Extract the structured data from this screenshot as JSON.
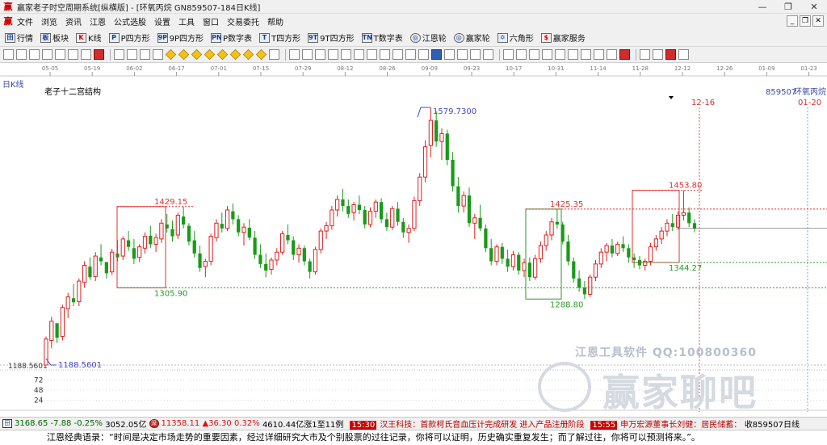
{
  "window": {
    "title": "赢家老子时空周期系统[纵横版] - [环氧丙烷  GN859507-184日K线]",
    "controls": [
      "—",
      "❐",
      "✕"
    ],
    "mdi_controls": [
      "_",
      "❐",
      "✕"
    ]
  },
  "menu": [
    "文件",
    "浏览",
    "资讯",
    "江恩",
    "公式选股",
    "设置",
    "工具",
    "窗口",
    "交易委托",
    "帮助"
  ],
  "toolbar": [
    {
      "icon": "grid-icon",
      "glyph": "田",
      "label": "行情"
    },
    {
      "icon": "blocks-icon",
      "glyph": "板",
      "label": "板块"
    },
    {
      "icon": "kline-icon",
      "glyph": "K",
      "label": "K线"
    },
    {
      "icon": "square-icon",
      "glyph": "P",
      "label": "P四方形"
    },
    {
      "icon": "square-icon",
      "glyph": "9P",
      "label": "9P四方形"
    },
    {
      "icon": "square-icon",
      "glyph": "PN",
      "label": "P数字表"
    },
    {
      "icon": "square-icon",
      "glyph": "T",
      "label": "T四方形"
    },
    {
      "icon": "square-icon",
      "glyph": "9T",
      "label": "9T四方形"
    },
    {
      "icon": "table-icon",
      "glyph": "TN",
      "label": "T数字表"
    },
    {
      "icon": "wheel-icon",
      "glyph": "◎",
      "label": "江恩轮"
    },
    {
      "icon": "wheel-icon",
      "glyph": "◎",
      "label": "赢家轮"
    },
    {
      "icon": "hexagon-icon",
      "glyph": "✡",
      "label": "六角形"
    },
    {
      "icon": "dollar-icon",
      "glyph": "$",
      "label": "赢家服务"
    }
  ],
  "chart_panel": {
    "period_label": "日K线",
    "indicator_label": "老子十二宫结构",
    "code_label": "859507",
    "name_label": "环氧丙烷",
    "date_marker_1": "12-16",
    "date_marker_2": "01-20"
  },
  "status": {
    "index1": "3168.65",
    "index1_change": "-7.88",
    "index1_pct": "-0.25%",
    "index1_amount": "3052.05亿",
    "index2": "11358.11",
    "index2_change": "▲36.30",
    "index2_pct": "0.32%",
    "index2_amount": "4610.44亿",
    "ratio": "涨1至11例",
    "news_time": "15:30",
    "news_text": "汉王科技：首款柯氏音血压计完成研发 进入产品注册阶段",
    "news_time2": "15:55",
    "news_text2": "申万宏源董事长刘健：居民储蓄：",
    "end_label": "收859507日线"
  },
  "quote": "江恩经典语录：“时间是决定市场走势的重要因素，经过详细研究大市及个别股票的过往记录，你将可以证明，历史确实重复发生；而了解过往，你将可以预测将来。”。",
  "watermark": {
    "line1": "江恩工具软件  QQ:100800360",
    "line2": "赢家聊吧"
  },
  "colors": {
    "up": "#e02020",
    "down": "#1a9a1a",
    "green_line": "#2a9a2a",
    "red_line": "#e03030",
    "blue_line": "#4444cc",
    "axis_text": "#3b4aa6"
  },
  "chart_data": {
    "type": "candlestick",
    "series_name": "环氧丙烷",
    "x_tick_labels": [
      "05-05",
      "05-19",
      "06-02",
      "06-17",
      "07-01",
      "07-15",
      "07-29",
      "08-12",
      "08-26",
      "09-09",
      "09-23",
      "10-17",
      "10-31",
      "11-14",
      "11-28",
      "12-12",
      "12-26",
      "01-09",
      "01-23"
    ],
    "price_labels": {
      "low": "1188.5601",
      "low_axis": "1188.5601",
      "high": "1579.7300",
      "box1_top": "1429.15",
      "box1_bottom": "1305.90",
      "box2_top": "1425.35",
      "box2_bottom": "1288.80",
      "box3_top": "1453.80",
      "box3_bottom": "1344.27"
    },
    "volume_axis_ticks": [
      "72",
      "48",
      "24"
    ],
    "ohlc": [
      [
        1188.56,
        1232,
        1188.56,
        1228
      ],
      [
        1226,
        1262,
        1214,
        1255
      ],
      [
        1252,
        1248,
        1222,
        1230
      ],
      [
        1232,
        1280,
        1226,
        1276
      ],
      [
        1274,
        1298,
        1260,
        1292
      ],
      [
        1290,
        1312,
        1278,
        1284
      ],
      [
        1285,
        1320,
        1278,
        1316
      ],
      [
        1314,
        1346,
        1306,
        1340
      ],
      [
        1338,
        1352,
        1318,
        1322
      ],
      [
        1323,
        1360,
        1316,
        1354
      ],
      [
        1352,
        1372,
        1340,
        1346
      ],
      [
        1345,
        1338,
        1320,
        1328
      ],
      [
        1330,
        1365,
        1325,
        1360
      ],
      [
        1358,
        1378,
        1346,
        1352
      ],
      [
        1354,
        1384,
        1348,
        1380
      ],
      [
        1378,
        1392,
        1362,
        1368
      ],
      [
        1366,
        1380,
        1342,
        1350
      ],
      [
        1352,
        1372,
        1345,
        1368
      ],
      [
        1366,
        1390,
        1358,
        1384
      ],
      [
        1385,
        1400,
        1366,
        1372
      ],
      [
        1372,
        1388,
        1360,
        1382
      ],
      [
        1380,
        1410,
        1374,
        1404
      ],
      [
        1402,
        1418,
        1390,
        1396
      ],
      [
        1395,
        1408,
        1376,
        1384
      ],
      [
        1386,
        1420,
        1380,
        1416
      ],
      [
        1414,
        1429.15,
        1396,
        1402
      ],
      [
        1400,
        1404,
        1370,
        1376
      ],
      [
        1378,
        1392,
        1352,
        1358
      ],
      [
        1358,
        1370,
        1330,
        1336
      ],
      [
        1338,
        1350,
        1322,
        1346
      ],
      [
        1346,
        1388,
        1340,
        1384
      ],
      [
        1382,
        1410,
        1376,
        1404
      ],
      [
        1403,
        1420,
        1390,
        1396
      ],
      [
        1396,
        1430,
        1392,
        1424
      ],
      [
        1422,
        1434,
        1402,
        1410
      ],
      [
        1410,
        1416,
        1384,
        1390
      ],
      [
        1390,
        1404,
        1370,
        1398
      ],
      [
        1397,
        1410,
        1378,
        1382
      ],
      [
        1382,
        1392,
        1350,
        1356
      ],
      [
        1356,
        1372,
        1336,
        1342
      ],
      [
        1342,
        1358,
        1322,
        1332
      ],
      [
        1334,
        1352,
        1326,
        1348
      ],
      [
        1348,
        1366,
        1340,
        1360
      ],
      [
        1360,
        1392,
        1356,
        1388
      ],
      [
        1386,
        1402,
        1372,
        1378
      ],
      [
        1378,
        1384,
        1348,
        1356
      ],
      [
        1356,
        1372,
        1344,
        1366
      ],
      [
        1366,
        1370,
        1340,
        1346
      ],
      [
        1346,
        1350,
        1320,
        1330
      ],
      [
        1330,
        1368,
        1326,
        1364
      ],
      [
        1364,
        1396,
        1358,
        1392
      ],
      [
        1392,
        1406,
        1380,
        1400
      ],
      [
        1400,
        1430,
        1394,
        1424
      ],
      [
        1424,
        1446,
        1414,
        1440
      ],
      [
        1440,
        1456,
        1422,
        1430
      ],
      [
        1430,
        1440,
        1412,
        1418
      ],
      [
        1420,
        1436,
        1408,
        1432
      ],
      [
        1432,
        1446,
        1418,
        1424
      ],
      [
        1424,
        1430,
        1396,
        1402
      ],
      [
        1402,
        1428,
        1398,
        1422
      ],
      [
        1422,
        1440,
        1412,
        1436
      ],
      [
        1436,
        1442,
        1404,
        1410
      ],
      [
        1410,
        1420,
        1392,
        1398
      ],
      [
        1398,
        1430,
        1394,
        1426
      ],
      [
        1426,
        1436,
        1400,
        1406
      ],
      [
        1406,
        1412,
        1382,
        1390
      ],
      [
        1390,
        1402,
        1374,
        1396
      ],
      [
        1396,
        1444,
        1392,
        1438
      ],
      [
        1438,
        1480,
        1430,
        1474
      ],
      [
        1474,
        1530,
        1466,
        1520
      ],
      [
        1522,
        1579.73,
        1504,
        1560
      ],
      [
        1560,
        1574,
        1520,
        1528
      ],
      [
        1528,
        1548,
        1500,
        1540
      ],
      [
        1540,
        1546,
        1492,
        1500
      ],
      [
        1500,
        1512,
        1452,
        1460
      ],
      [
        1460,
        1474,
        1420,
        1430
      ],
      [
        1430,
        1452,
        1420,
        1446
      ],
      [
        1446,
        1458,
        1398,
        1404
      ],
      [
        1404,
        1418,
        1380,
        1412
      ],
      [
        1412,
        1432,
        1392,
        1396
      ],
      [
        1396,
        1402,
        1360,
        1366
      ],
      [
        1366,
        1380,
        1340,
        1346
      ],
      [
        1346,
        1372,
        1340,
        1368
      ],
      [
        1368,
        1374,
        1342,
        1350
      ],
      [
        1350,
        1364,
        1330,
        1338
      ],
      [
        1338,
        1362,
        1332,
        1356
      ],
      [
        1356,
        1360,
        1326,
        1332
      ],
      [
        1332,
        1350,
        1322,
        1344
      ],
      [
        1344,
        1352,
        1316,
        1322
      ],
      [
        1322,
        1356,
        1318,
        1350
      ],
      [
        1350,
        1376,
        1344,
        1370
      ],
      [
        1370,
        1392,
        1362,
        1386
      ],
      [
        1386,
        1412,
        1378,
        1406
      ],
      [
        1406,
        1425.35,
        1396,
        1402
      ],
      [
        1402,
        1406,
        1372,
        1376
      ],
      [
        1376,
        1386,
        1340,
        1346
      ],
      [
        1346,
        1352,
        1314,
        1320
      ],
      [
        1320,
        1332,
        1300,
        1306
      ],
      [
        1306,
        1316,
        1288.8,
        1296
      ],
      [
        1296,
        1326,
        1292,
        1322
      ],
      [
        1322,
        1348,
        1316,
        1342
      ],
      [
        1342,
        1366,
        1336,
        1360
      ],
      [
        1360,
        1374,
        1346,
        1370
      ],
      [
        1370,
        1380,
        1352,
        1358
      ],
      [
        1358,
        1376,
        1354,
        1372
      ],
      [
        1372,
        1384,
        1360,
        1366
      ],
      [
        1366,
        1372,
        1344,
        1352
      ],
      [
        1352,
        1358,
        1336,
        1348
      ],
      [
        1348,
        1354,
        1334,
        1340
      ],
      [
        1340,
        1350,
        1332,
        1346
      ],
      [
        1346,
        1374,
        1340,
        1368
      ],
      [
        1368,
        1386,
        1362,
        1380
      ],
      [
        1380,
        1398,
        1372,
        1392
      ],
      [
        1392,
        1410,
        1384,
        1404
      ],
      [
        1404,
        1418,
        1392,
        1398
      ],
      [
        1398,
        1422,
        1394,
        1416
      ],
      [
        1416,
        1453.8,
        1408,
        1420
      ],
      [
        1420,
        1428,
        1398,
        1404
      ],
      [
        1404,
        1410,
        1390,
        1396
      ]
    ],
    "volume_scale": [
      0,
      96
    ]
  }
}
